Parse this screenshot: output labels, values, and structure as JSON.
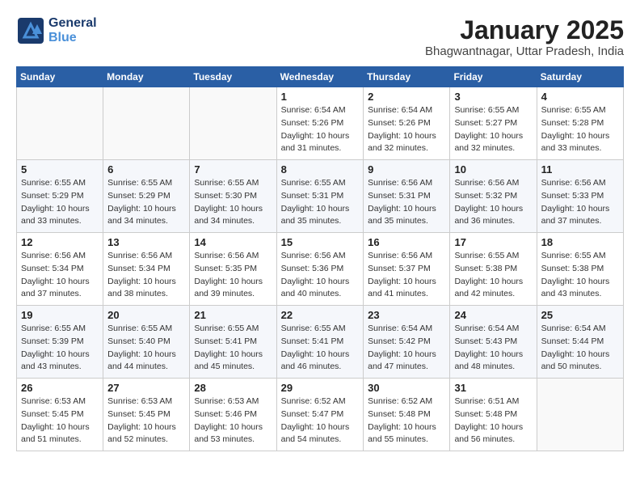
{
  "logo": {
    "general": "General",
    "blue": "Blue"
  },
  "header": {
    "month": "January 2025",
    "location": "Bhagwantnagar, Uttar Pradesh, India"
  },
  "weekdays": [
    "Sunday",
    "Monday",
    "Tuesday",
    "Wednesday",
    "Thursday",
    "Friday",
    "Saturday"
  ],
  "weeks": [
    [
      {
        "day": "",
        "sunrise": "",
        "sunset": "",
        "daylight": ""
      },
      {
        "day": "",
        "sunrise": "",
        "sunset": "",
        "daylight": ""
      },
      {
        "day": "",
        "sunrise": "",
        "sunset": "",
        "daylight": ""
      },
      {
        "day": "1",
        "sunrise": "Sunrise: 6:54 AM",
        "sunset": "Sunset: 5:26 PM",
        "daylight": "Daylight: 10 hours and 31 minutes."
      },
      {
        "day": "2",
        "sunrise": "Sunrise: 6:54 AM",
        "sunset": "Sunset: 5:26 PM",
        "daylight": "Daylight: 10 hours and 32 minutes."
      },
      {
        "day": "3",
        "sunrise": "Sunrise: 6:55 AM",
        "sunset": "Sunset: 5:27 PM",
        "daylight": "Daylight: 10 hours and 32 minutes."
      },
      {
        "day": "4",
        "sunrise": "Sunrise: 6:55 AM",
        "sunset": "Sunset: 5:28 PM",
        "daylight": "Daylight: 10 hours and 33 minutes."
      }
    ],
    [
      {
        "day": "5",
        "sunrise": "Sunrise: 6:55 AM",
        "sunset": "Sunset: 5:29 PM",
        "daylight": "Daylight: 10 hours and 33 minutes."
      },
      {
        "day": "6",
        "sunrise": "Sunrise: 6:55 AM",
        "sunset": "Sunset: 5:29 PM",
        "daylight": "Daylight: 10 hours and 34 minutes."
      },
      {
        "day": "7",
        "sunrise": "Sunrise: 6:55 AM",
        "sunset": "Sunset: 5:30 PM",
        "daylight": "Daylight: 10 hours and 34 minutes."
      },
      {
        "day": "8",
        "sunrise": "Sunrise: 6:55 AM",
        "sunset": "Sunset: 5:31 PM",
        "daylight": "Daylight: 10 hours and 35 minutes."
      },
      {
        "day": "9",
        "sunrise": "Sunrise: 6:56 AM",
        "sunset": "Sunset: 5:31 PM",
        "daylight": "Daylight: 10 hours and 35 minutes."
      },
      {
        "day": "10",
        "sunrise": "Sunrise: 6:56 AM",
        "sunset": "Sunset: 5:32 PM",
        "daylight": "Daylight: 10 hours and 36 minutes."
      },
      {
        "day": "11",
        "sunrise": "Sunrise: 6:56 AM",
        "sunset": "Sunset: 5:33 PM",
        "daylight": "Daylight: 10 hours and 37 minutes."
      }
    ],
    [
      {
        "day": "12",
        "sunrise": "Sunrise: 6:56 AM",
        "sunset": "Sunset: 5:34 PM",
        "daylight": "Daylight: 10 hours and 37 minutes."
      },
      {
        "day": "13",
        "sunrise": "Sunrise: 6:56 AM",
        "sunset": "Sunset: 5:34 PM",
        "daylight": "Daylight: 10 hours and 38 minutes."
      },
      {
        "day": "14",
        "sunrise": "Sunrise: 6:56 AM",
        "sunset": "Sunset: 5:35 PM",
        "daylight": "Daylight: 10 hours and 39 minutes."
      },
      {
        "day": "15",
        "sunrise": "Sunrise: 6:56 AM",
        "sunset": "Sunset: 5:36 PM",
        "daylight": "Daylight: 10 hours and 40 minutes."
      },
      {
        "day": "16",
        "sunrise": "Sunrise: 6:56 AM",
        "sunset": "Sunset: 5:37 PM",
        "daylight": "Daylight: 10 hours and 41 minutes."
      },
      {
        "day": "17",
        "sunrise": "Sunrise: 6:55 AM",
        "sunset": "Sunset: 5:38 PM",
        "daylight": "Daylight: 10 hours and 42 minutes."
      },
      {
        "day": "18",
        "sunrise": "Sunrise: 6:55 AM",
        "sunset": "Sunset: 5:38 PM",
        "daylight": "Daylight: 10 hours and 43 minutes."
      }
    ],
    [
      {
        "day": "19",
        "sunrise": "Sunrise: 6:55 AM",
        "sunset": "Sunset: 5:39 PM",
        "daylight": "Daylight: 10 hours and 43 minutes."
      },
      {
        "day": "20",
        "sunrise": "Sunrise: 6:55 AM",
        "sunset": "Sunset: 5:40 PM",
        "daylight": "Daylight: 10 hours and 44 minutes."
      },
      {
        "day": "21",
        "sunrise": "Sunrise: 6:55 AM",
        "sunset": "Sunset: 5:41 PM",
        "daylight": "Daylight: 10 hours and 45 minutes."
      },
      {
        "day": "22",
        "sunrise": "Sunrise: 6:55 AM",
        "sunset": "Sunset: 5:41 PM",
        "daylight": "Daylight: 10 hours and 46 minutes."
      },
      {
        "day": "23",
        "sunrise": "Sunrise: 6:54 AM",
        "sunset": "Sunset: 5:42 PM",
        "daylight": "Daylight: 10 hours and 47 minutes."
      },
      {
        "day": "24",
        "sunrise": "Sunrise: 6:54 AM",
        "sunset": "Sunset: 5:43 PM",
        "daylight": "Daylight: 10 hours and 48 minutes."
      },
      {
        "day": "25",
        "sunrise": "Sunrise: 6:54 AM",
        "sunset": "Sunset: 5:44 PM",
        "daylight": "Daylight: 10 hours and 50 minutes."
      }
    ],
    [
      {
        "day": "26",
        "sunrise": "Sunrise: 6:53 AM",
        "sunset": "Sunset: 5:45 PM",
        "daylight": "Daylight: 10 hours and 51 minutes."
      },
      {
        "day": "27",
        "sunrise": "Sunrise: 6:53 AM",
        "sunset": "Sunset: 5:45 PM",
        "daylight": "Daylight: 10 hours and 52 minutes."
      },
      {
        "day": "28",
        "sunrise": "Sunrise: 6:53 AM",
        "sunset": "Sunset: 5:46 PM",
        "daylight": "Daylight: 10 hours and 53 minutes."
      },
      {
        "day": "29",
        "sunrise": "Sunrise: 6:52 AM",
        "sunset": "Sunset: 5:47 PM",
        "daylight": "Daylight: 10 hours and 54 minutes."
      },
      {
        "day": "30",
        "sunrise": "Sunrise: 6:52 AM",
        "sunset": "Sunset: 5:48 PM",
        "daylight": "Daylight: 10 hours and 55 minutes."
      },
      {
        "day": "31",
        "sunrise": "Sunrise: 6:51 AM",
        "sunset": "Sunset: 5:48 PM",
        "daylight": "Daylight: 10 hours and 56 minutes."
      },
      {
        "day": "",
        "sunrise": "",
        "sunset": "",
        "daylight": ""
      }
    ]
  ]
}
